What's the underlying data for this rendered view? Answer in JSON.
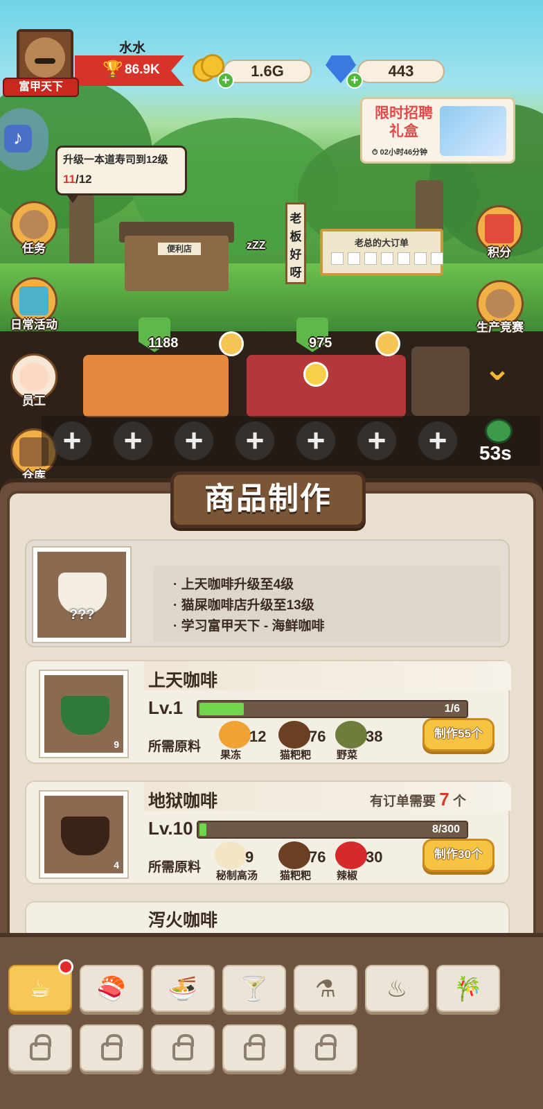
{
  "player": {
    "name": "水水",
    "title": "富甲天下",
    "trophy_value": "86.9K"
  },
  "resources": {
    "gold": "1.6G",
    "gems": "443"
  },
  "gift_box": {
    "title": "限时招聘礼盒",
    "timer": "02小时46分钟"
  },
  "quest_bubble": {
    "text": "升级一本道寿司到12级",
    "progress_current": "11",
    "progress_total": "/12"
  },
  "left_menu": [
    {
      "label": "任务",
      "icon": "mustache-bear-icon"
    },
    {
      "label": "日常活动",
      "icon": "arcade-machine-icon"
    },
    {
      "label": "员工",
      "icon": "smiley-face-icon"
    },
    {
      "label": "仓库",
      "icon": "treasure-chest-icon"
    }
  ],
  "right_menu": [
    {
      "label": "积分",
      "icon": "gift-box-icon"
    },
    {
      "label": "生产竞赛",
      "icon": "chef-bear-trophy-icon"
    }
  ],
  "scene": {
    "shop_sign": "老板好呀",
    "order_board_title": "老总的大订单",
    "store_name": "便利店",
    "counter_left": "1188",
    "counter_right": "975",
    "sleep_text": "zZZ",
    "timer": "53s"
  },
  "panel": {
    "title": "商品制作",
    "locked_product": {
      "image_caption": "???",
      "requirements": [
        "· 上天咖啡升级至4级",
        "· 猫屎咖啡店升级至13级",
        "· 学习富甲天下 - 海鲜咖啡"
      ]
    },
    "products": [
      {
        "name": "上天咖啡",
        "stock": "9",
        "level": "Lv.1",
        "progress_text": "1/6",
        "progress": 0.1667,
        "materials_label": "所需原料",
        "materials": [
          {
            "name": "果冻",
            "qty": "12",
            "icon": "jelly-icon"
          },
          {
            "name": "猫粑粑",
            "qty": "76",
            "icon": "poop-icon"
          },
          {
            "name": "野菜",
            "qty": "38",
            "icon": "wild-herb-icon"
          }
        ],
        "make_label": "制作55个",
        "order_prefix": "",
        "order_count": "",
        "order_suffix": ""
      },
      {
        "name": "地狱咖啡",
        "stock": "4",
        "level": "Lv.10",
        "progress_text": "8/300",
        "progress": 0.0267,
        "materials_label": "所需原料",
        "materials": [
          {
            "name": "秘制高汤",
            "qty": "9",
            "icon": "soup-bowl-icon"
          },
          {
            "name": "猫粑粑",
            "qty": "76",
            "icon": "poop-icon"
          },
          {
            "name": "辣椒",
            "qty": "30",
            "icon": "chili-pepper-icon"
          }
        ],
        "make_label": "制作30个",
        "order_prefix": "有订单需要",
        "order_count": "7",
        "order_suffix": "个"
      }
    ],
    "peek_product": {
      "name": "泻火咖啡"
    }
  },
  "tabs": [
    {
      "icon": "coffee-cup-icon",
      "glyph": "☕",
      "state": "active"
    },
    {
      "icon": "sushi-icon",
      "glyph": "🍣",
      "state": "normal"
    },
    {
      "icon": "noodle-bowl-icon",
      "glyph": "🍜",
      "state": "normal"
    },
    {
      "icon": "cocktail-icon",
      "glyph": "🍸",
      "state": "normal"
    },
    {
      "icon": "flask-icon",
      "glyph": "⚗",
      "state": "normal"
    },
    {
      "icon": "grill-icon",
      "glyph": "♨",
      "state": "normal"
    },
    {
      "icon": "bamboo-icon",
      "glyph": "🎋",
      "state": "normal"
    }
  ],
  "colors": {
    "accent_gold": "#f6c343",
    "progress_green": "#6ed74a",
    "alert_red": "#d53a2a",
    "panel_brown": "#6b4f3a"
  }
}
